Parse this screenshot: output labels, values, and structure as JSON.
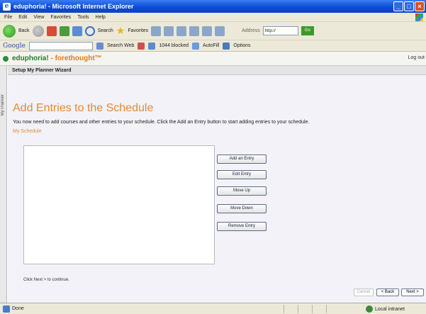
{
  "window": {
    "title": "eduphoria! - Microsoft Internet Explorer"
  },
  "menu": {
    "items": [
      "File",
      "Edit",
      "View",
      "Favorites",
      "Tools",
      "Help"
    ]
  },
  "toolbar": {
    "back_label": "Back",
    "search_label": "Search",
    "favorites_label": "Favorites",
    "address_label": "Address",
    "address_value": "http://",
    "go_label": "Go"
  },
  "google_bar": {
    "logo": "Google",
    "search_web_label": "Search Web",
    "blocked_label": "1044 blocked",
    "autofill_label": "AutoFill",
    "options_label": "Options"
  },
  "site": {
    "brand_part1": "eduphoria!",
    "brand_sep": " - ",
    "brand_part2": "forethought™",
    "logout_label": "Log out"
  },
  "side_tab": {
    "label": "My Planner"
  },
  "wizard": {
    "title": "Setup My Planner Wizard",
    "heading": "Add Entries to the Schedule",
    "intro": "You now need to add courses and other entries to your schedule. Click the Add an Entry button to start adding entries to your schedule.",
    "schedule_label": "My Schedule",
    "buttons": {
      "add": "Add an Entry",
      "edit": "Edit Entry",
      "up": "Move Up",
      "down": "Move Down",
      "remove": "Remove Entry"
    },
    "footer_note": "Click Next > to continue.",
    "nav": {
      "cancel": "Cancel",
      "back": "< Back",
      "next": "Next >"
    }
  },
  "status": {
    "text": "Done",
    "zone": "Local intranet"
  }
}
